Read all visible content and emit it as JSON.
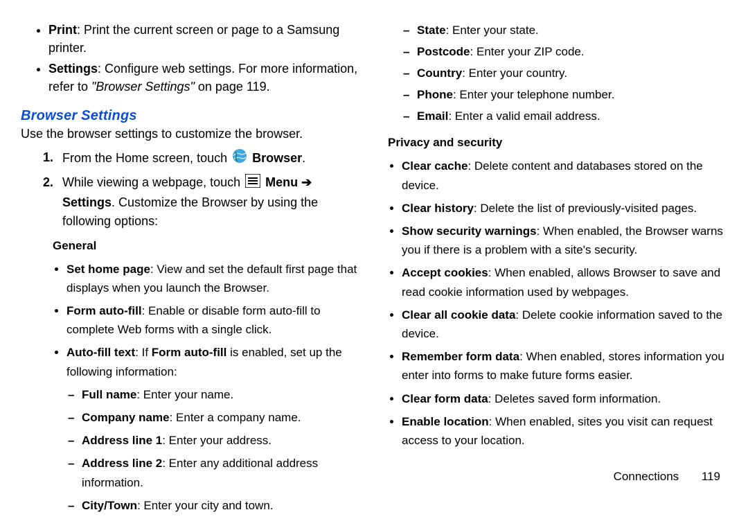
{
  "left": {
    "top_bullets": [
      {
        "term": "Print",
        "desc": ": Print the current screen or page to a Samsung printer."
      },
      {
        "term": "Settings",
        "desc": ": Configure web settings. For more information, refer to ",
        "xref": "\"Browser Settings\"",
        "xref_suffix": " on page 119."
      }
    ],
    "heading": "Browser Settings",
    "intro": "Use the browser settings to customize the browser.",
    "steps": {
      "s1_a": "From the Home screen, touch ",
      "s1_b": "Browser",
      "s1_c": ".",
      "s2_a": "While viewing a webpage, touch ",
      "s2_b": "Menu",
      "s2_arrow": " ➔ ",
      "s2_c": "Settings",
      "s2_d": ". Customize the Browser by using the following options:"
    },
    "general_heading": "General",
    "general_opts": [
      {
        "term": "Set home page",
        "desc": ": View and set the default first page that displays when you launch the Browser."
      },
      {
        "term": "Form auto-fill",
        "desc": ": Enable or disable form auto-fill to complete Web forms with a single click."
      }
    ],
    "autofill": {
      "prefix": "Auto-fill text",
      "mid": ": If ",
      "bold2": "Form auto-fill",
      "suffix": " is enabled, set up the following information:"
    },
    "autofill_fields_left": [
      {
        "term": "Full name",
        "desc": ": Enter your name."
      },
      {
        "term": "Company name",
        "desc": ": Enter a company name."
      },
      {
        "term": "Address line 1",
        "desc": ": Enter your address."
      },
      {
        "term": "Address line 2",
        "desc": ": Enter any additional address information."
      },
      {
        "term": "City/Town",
        "desc": ": Enter your city and town."
      }
    ]
  },
  "right": {
    "autofill_fields_right": [
      {
        "term": "State",
        "desc": ": Enter your state."
      },
      {
        "term": "Postcode",
        "desc": ": Enter your ZIP code."
      },
      {
        "term": "Country",
        "desc": ": Enter your country."
      },
      {
        "term": "Phone",
        "desc": ": Enter your telephone number."
      },
      {
        "term": "Email",
        "desc": ": Enter a valid email address."
      }
    ],
    "privacy_heading": "Privacy and security",
    "privacy_opts": [
      {
        "term": "Clear cache",
        "desc": ": Delete content and databases stored on the device."
      },
      {
        "term": "Clear history",
        "desc": ": Delete the list of previously-visited pages."
      },
      {
        "term": "Show security warnings",
        "desc": ": When enabled, the Browser warns you if there is a problem with a site's security."
      },
      {
        "term": "Accept cookies",
        "desc": ": When enabled, allows Browser to save and read cookie information used by webpages."
      },
      {
        "term": "Clear all cookie data",
        "desc": ": Delete cookie information saved to the device."
      },
      {
        "term": "Remember form data",
        "desc": ": When enabled, stores information you enter into forms to make future forms easier."
      },
      {
        "term": "Clear form data",
        "desc": ": Deletes saved form information."
      },
      {
        "term": "Enable location",
        "desc": ": When enabled, sites you visit can request access to your location."
      }
    ]
  },
  "footer": {
    "section": "Connections",
    "page": "119"
  }
}
